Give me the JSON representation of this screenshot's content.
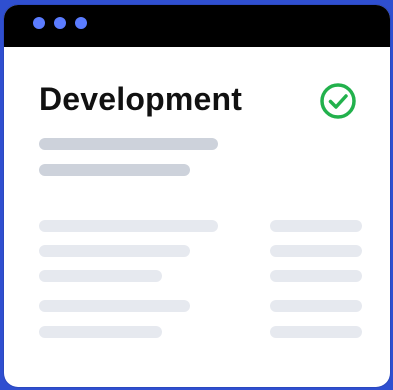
{
  "window": {
    "title": "Development",
    "status_icon": "check-circle-icon",
    "colors": {
      "background": "#2f4fd0",
      "titlebar": "#000000",
      "window_dots": "#5b7cff",
      "check": "#22b14c",
      "placeholder_dark": "#cdd2db",
      "placeholder_light": "#e6e9ef"
    }
  }
}
